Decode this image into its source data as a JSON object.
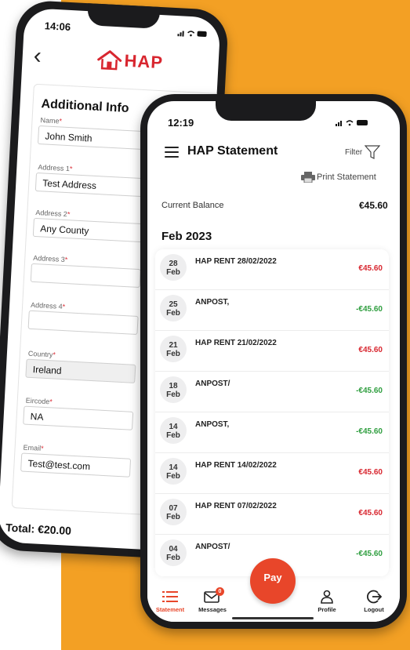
{
  "brand": {
    "accent_red": "#d8262f",
    "orange": "#f3a024",
    "pay_red": "#e8462a",
    "positive_green": "#2f9e3f"
  },
  "back_phone": {
    "time": "14:06",
    "back_icon": "chevron-left-icon",
    "logo_text": "HAP",
    "form_title": "Additional Info",
    "fields": [
      {
        "label": "Name",
        "value": ""
      },
      {
        "label": "Address 1",
        "value": "Test Address"
      },
      {
        "label": "Address 2",
        "value": "Any County"
      },
      {
        "label": "Address 3",
        "value": ""
      },
      {
        "label": "Address 4",
        "value": ""
      },
      {
        "label": "Country",
        "value": "Ireland"
      },
      {
        "label": "Eircode",
        "value": "NA"
      },
      {
        "label": "Email",
        "value": "Test@test.com"
      }
    ],
    "name_value": "John Smith",
    "total": "Total: €20.00"
  },
  "front_phone": {
    "time": "12:19",
    "title": "HAP Statement",
    "filter_label": "Filter",
    "print_label": "Print Statement",
    "balance_label": "Current Balance",
    "balance_value": "€45.60",
    "month": "Feb 2023",
    "transactions": [
      {
        "day": "28",
        "mon": "Feb",
        "desc": "HAP RENT 28/02/2022",
        "amount": "€45.60",
        "type": "neg"
      },
      {
        "day": "25",
        "mon": "Feb",
        "desc": "ANPOST,",
        "amount": "-€45.60",
        "type": "pos"
      },
      {
        "day": "21",
        "mon": "Feb",
        "desc": "HAP RENT 21/02/2022",
        "amount": "€45.60",
        "type": "neg"
      },
      {
        "day": "18",
        "mon": "Feb",
        "desc": "ANPOST/",
        "amount": "-€45.60",
        "type": "pos"
      },
      {
        "day": "14",
        "mon": "Feb",
        "desc": "ANPOST,",
        "amount": "-€45.60",
        "type": "pos"
      },
      {
        "day": "14",
        "mon": "Feb",
        "desc": "HAP RENT 14/02/2022",
        "amount": "€45.60",
        "type": "neg"
      },
      {
        "day": "07",
        "mon": "Feb",
        "desc": "HAP RENT 07/02/2022",
        "amount": "€45.60",
        "type": "neg"
      },
      {
        "day": "04",
        "mon": "Feb",
        "desc": "ANPOST/",
        "amount": "-€45.60",
        "type": "pos"
      }
    ],
    "tabs": {
      "statement": "Statement",
      "messages": "Messages",
      "messages_badge": "0",
      "pay": "Pay",
      "profile": "Profile",
      "logout": "Logout"
    }
  }
}
